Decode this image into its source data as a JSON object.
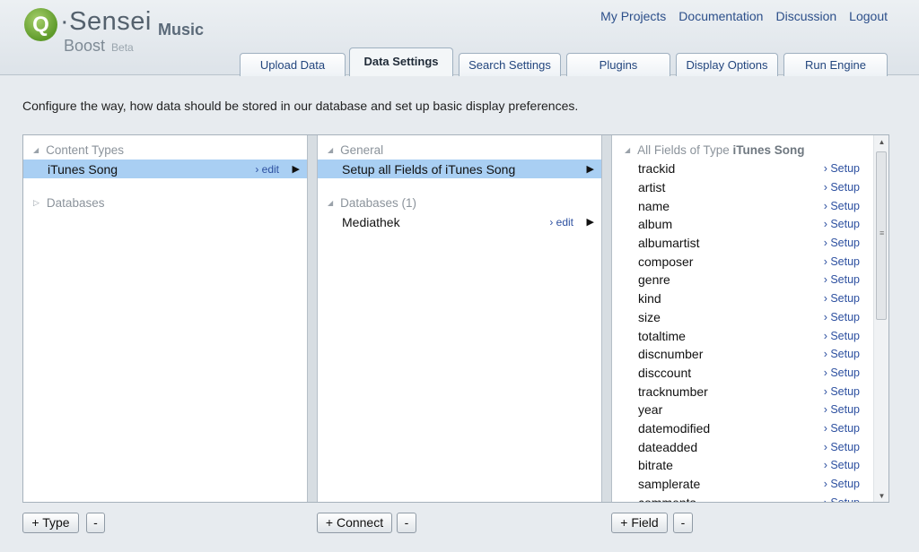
{
  "brand": {
    "q_letter": "Q",
    "name": "·Sensei",
    "product": "Boost",
    "beta": "Beta",
    "app": "Music"
  },
  "toplinks": [
    "My Projects",
    "Documentation",
    "Discussion",
    "Logout"
  ],
  "tabs": [
    "Upload Data",
    "Data Settings",
    "Search Settings",
    "Plugins",
    "Display Options",
    "Run Engine"
  ],
  "active_tab": "Data Settings",
  "intro": "Configure the way, how data should be stored in our database and set up basic display preferences.",
  "panel1": {
    "content_types_header": "Content Types",
    "selected_item": "iTunes Song",
    "edit_label": "› edit",
    "databases_header": "Databases"
  },
  "panel2": {
    "general_header": "General",
    "setup_item": "Setup all Fields of iTunes Song",
    "databases_header": "Databases (1)",
    "db_item": "Mediathek",
    "edit_label": "› edit"
  },
  "panel3": {
    "header_prefix": "All Fields of Type ",
    "header_type": "iTunes Song",
    "setup_label": "› Setup",
    "fields": [
      "trackid",
      "artist",
      "name",
      "album",
      "albumartist",
      "composer",
      "genre",
      "kind",
      "size",
      "totaltime",
      "discnumber",
      "disccount",
      "tracknumber",
      "year",
      "datemodified",
      "dateadded",
      "bitrate",
      "samplerate",
      "comments"
    ]
  },
  "buttons": {
    "add_type": "+ Type",
    "remove_type": "-",
    "add_connect": "+ Connect",
    "remove_connect": "-",
    "add_field": "+ Field",
    "remove_field": "-"
  },
  "colors": {
    "selection": "#a9cff3",
    "link": "#2c4f8a",
    "logo_green": "#6aa832"
  }
}
